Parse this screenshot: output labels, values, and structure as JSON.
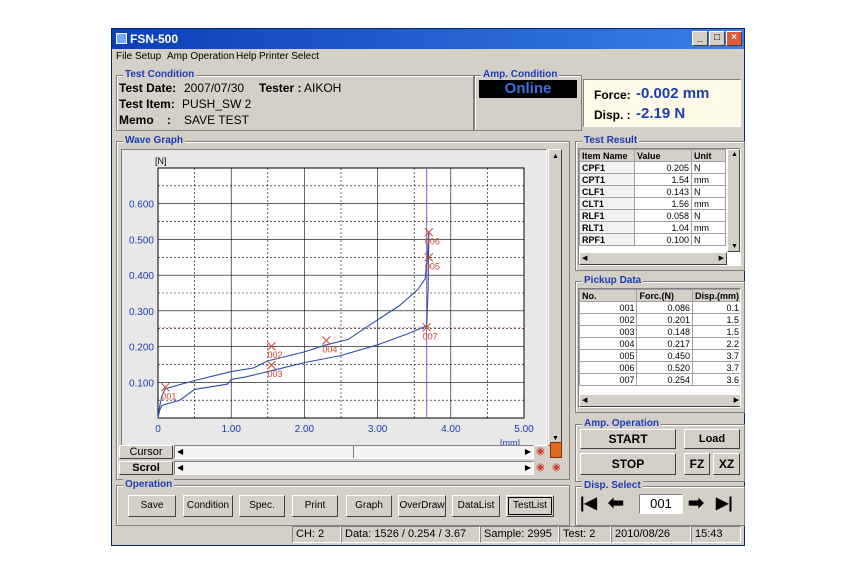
{
  "window": {
    "title": "FSN-500"
  },
  "menu": [
    "File",
    "Setup",
    "Amp Operation",
    "Help",
    "Printer Select"
  ],
  "test_condition": {
    "title": "Test Condition",
    "date_label": "Test Date:",
    "date_value": "2007/07/30",
    "tester_label": "Tester :",
    "tester_value": "AIKOH",
    "item_label": "Test Item:",
    "item_value": "PUSH_SW 2",
    "memo_label": "Memo",
    "memo_sep": ":",
    "memo_value": "SAVE TEST"
  },
  "amp_condition": {
    "title": "Amp. Condition",
    "status": "Online"
  },
  "readout": {
    "force_label": "Force:",
    "force_value": "-0.002 mm",
    "disp_label": "Disp. :",
    "disp_value": "-2.19  N"
  },
  "wave_graph": {
    "title": "Wave Graph"
  },
  "chart_data": {
    "type": "line",
    "ylabel": "[N]",
    "xlabel": "[mm]",
    "xlim": [
      0,
      5
    ],
    "ylim": [
      0,
      0.7
    ],
    "xticks": [
      "0",
      "1.00",
      "2.00",
      "3.00",
      "4.00",
      "5.00"
    ],
    "yticks": [
      "0.100",
      "0.200",
      "0.300",
      "0.400",
      "0.500",
      "0.600"
    ],
    "grid": true,
    "cursor_x": 3.67,
    "cursor_y": 0.254,
    "series": [
      {
        "points": [
          [
            0.0,
            0.0
          ],
          [
            0.02,
            0.03
          ],
          [
            0.05,
            0.06
          ],
          [
            0.1,
            0.082
          ],
          [
            0.5,
            0.105
          ],
          [
            1.0,
            0.13
          ],
          [
            1.3,
            0.14
          ],
          [
            1.5,
            0.16
          ],
          [
            1.6,
            0.165
          ],
          [
            2.0,
            0.185
          ],
          [
            2.3,
            0.205
          ],
          [
            2.6,
            0.22
          ],
          [
            3.0,
            0.275
          ],
          [
            3.3,
            0.315
          ],
          [
            3.55,
            0.36
          ],
          [
            3.65,
            0.39
          ],
          [
            3.68,
            0.45
          ],
          [
            3.7,
            0.52
          ]
        ]
      },
      {
        "points": [
          [
            3.7,
            0.52
          ],
          [
            3.69,
            0.36
          ],
          [
            3.67,
            0.258
          ],
          [
            3.4,
            0.235
          ],
          [
            3.0,
            0.205
          ],
          [
            2.5,
            0.175
          ],
          [
            2.0,
            0.155
          ],
          [
            1.6,
            0.135
          ],
          [
            1.2,
            0.115
          ],
          [
            1.0,
            0.108
          ],
          [
            0.95,
            0.095
          ],
          [
            0.5,
            0.08
          ],
          [
            0.3,
            0.05
          ],
          [
            0.05,
            0.035
          ],
          [
            0.02,
            0.02
          ],
          [
            0.0,
            0.0
          ]
        ]
      }
    ],
    "markers": [
      {
        "label": "001",
        "x": 0.1,
        "y": 0.086
      },
      {
        "label": "002",
        "x": 1.55,
        "y": 0.201
      },
      {
        "label": "003",
        "x": 1.55,
        "y": 0.148
      },
      {
        "label": "004",
        "x": 2.3,
        "y": 0.217
      },
      {
        "label": "005",
        "x": 3.7,
        "y": 0.45
      },
      {
        "label": "006",
        "x": 3.7,
        "y": 0.52
      },
      {
        "label": "007",
        "x": 3.67,
        "y": 0.254
      }
    ]
  },
  "cursor": {
    "label": "Cursor"
  },
  "scroll": {
    "label": "Scrol"
  },
  "test_result": {
    "title": "Test Result",
    "headers": [
      "Item Name",
      "Value",
      "Unit"
    ],
    "rows": [
      [
        "CPF1",
        "0.205",
        "N"
      ],
      [
        "CPT1",
        "1.54",
        "mm"
      ],
      [
        "CLF1",
        "0.143",
        "N"
      ],
      [
        "CLT1",
        "1.56",
        "mm"
      ],
      [
        "RLF1",
        "0.058",
        "N"
      ],
      [
        "RLT1",
        "1.04",
        "mm"
      ],
      [
        "RPF1",
        "0.100",
        "N"
      ]
    ]
  },
  "pickup_data": {
    "title": "Pickup Data",
    "headers": [
      "No.",
      "Forc.(N)",
      "Disp.(mm)"
    ],
    "rows": [
      [
        "001",
        "0.086",
        "0.1"
      ],
      [
        "002",
        "0.201",
        "1.5"
      ],
      [
        "003",
        "0.148",
        "1.5"
      ],
      [
        "004",
        "0.217",
        "2.2"
      ],
      [
        "005",
        "0.450",
        "3.7"
      ],
      [
        "006",
        "0.520",
        "3.7"
      ],
      [
        "007",
        "0.254",
        "3.6"
      ]
    ]
  },
  "amp_operation": {
    "title": "Amp. Operation",
    "start": "START",
    "stop": "STOP",
    "load": "Load",
    "fz": "FZ",
    "xz": "XZ"
  },
  "operation": {
    "title": "Operation",
    "buttons": [
      "Save",
      "Condition",
      "Spec.",
      "Print",
      "Graph",
      "OverDraw",
      "DataList",
      "TestList"
    ]
  },
  "disp_select": {
    "title": "Disp. Select",
    "value": "001"
  },
  "status_bar": {
    "ch": "CH: 2",
    "data": "Data: 1526 / 0.254 / 3.67",
    "sample": "Sample: 2995",
    "test": "Test:  2",
    "date": "2010/08/26",
    "time": "15:43"
  }
}
